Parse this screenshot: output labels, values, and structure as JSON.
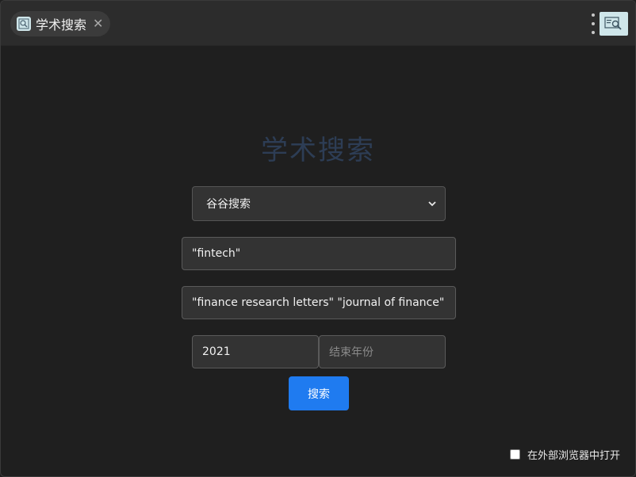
{
  "tab": {
    "title": "学术搜索",
    "close_glyph": "✕",
    "icon": "search-doc-icon"
  },
  "toolbar": {
    "menu_icon": "kebab-menu-icon",
    "app_icon": "search-doc-icon"
  },
  "main": {
    "heading": "学术搜索",
    "engine_select": {
      "value": "谷谷搜索"
    },
    "keyword_field": {
      "value": "\"fintech\""
    },
    "source_field": {
      "value": "\"finance research letters\" \"journal of finance\""
    },
    "start_year_field": {
      "value": "2021"
    },
    "end_year_field": {
      "placeholder": "结束年份"
    },
    "search_button": {
      "label": "搜索"
    },
    "open_external": {
      "label": "在外部浏览器中打开",
      "checked": false
    }
  },
  "colors": {
    "accent": "#1f7bf0",
    "heading": "#2d3d55",
    "background": "#1f1f1f"
  }
}
